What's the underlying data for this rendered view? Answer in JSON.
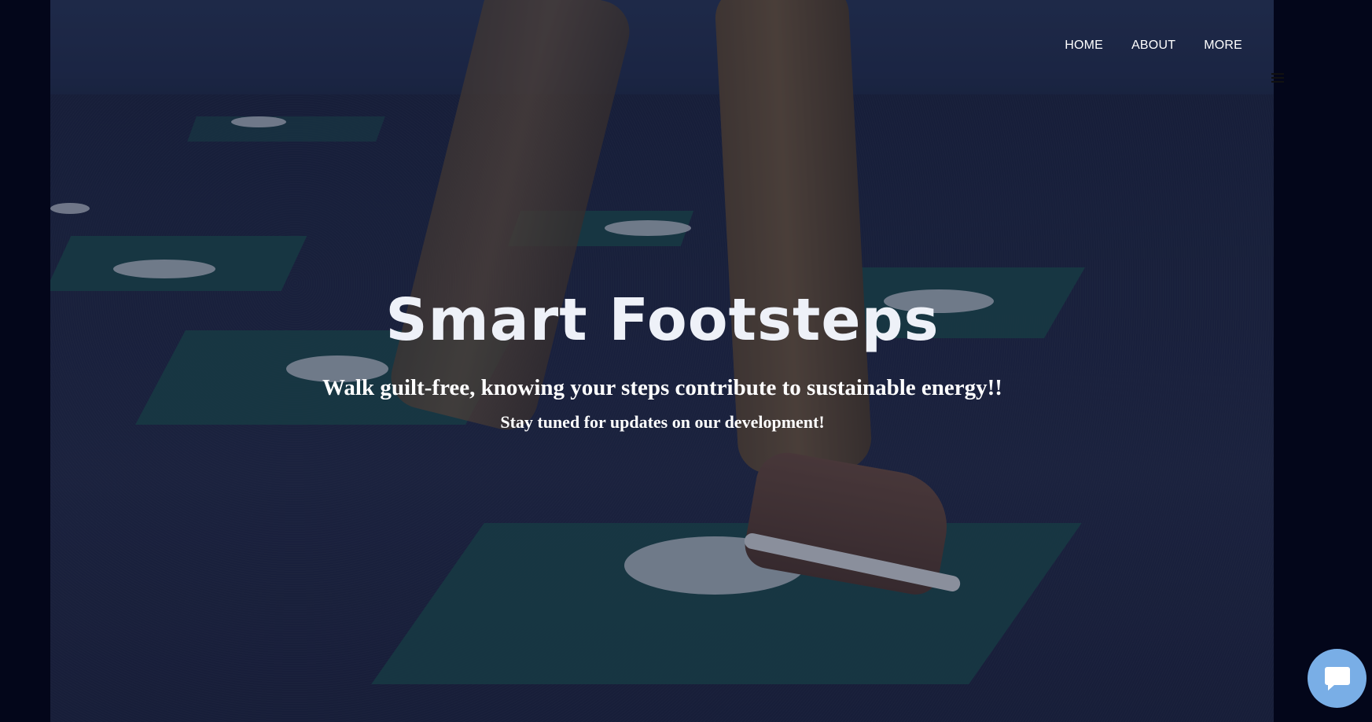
{
  "nav": {
    "items": [
      {
        "label": "HOME"
      },
      {
        "label": "ABOUT"
      },
      {
        "label": "MORE"
      }
    ],
    "menu_icon": "hamburger-icon"
  },
  "hero": {
    "title": "Smart Footsteps",
    "subtitle": "Walk guilt-free, knowing your steps contribute to sustainable energy!!",
    "tagline": "Stay tuned for updates on our development!"
  },
  "chat": {
    "icon": "chat-bubble-icon"
  },
  "colors": {
    "background": "#03061a",
    "text": "#ffffff",
    "chat_button": "#79aee6"
  }
}
